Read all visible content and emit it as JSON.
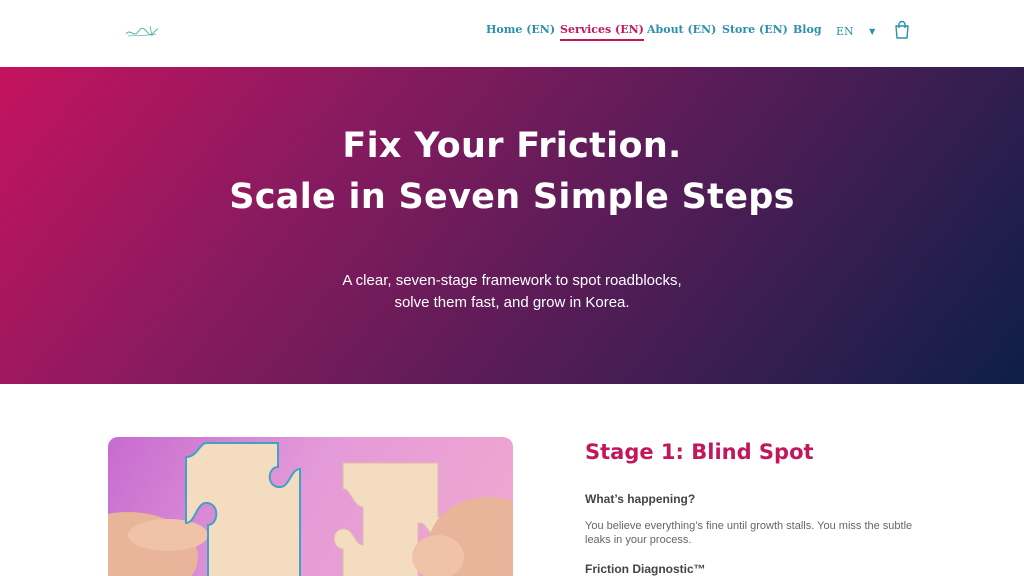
{
  "header": {
    "nav": [
      {
        "label": "Home (EN)"
      },
      {
        "label": "Services (EN)"
      },
      {
        "label": "About (EN)"
      },
      {
        "label": "Store (EN)"
      },
      {
        "label": "Blog"
      }
    ],
    "language": "EN"
  },
  "hero": {
    "title_line1": "Fix Your Friction.",
    "title_line2": "Scale in Seven Simple Steps",
    "subtitle_line1": "A clear, seven-stage framework to spot roadblocks,",
    "subtitle_line2": "solve them fast, and grow in Korea."
  },
  "stage": {
    "title": "Stage 1: Blind Spot",
    "question": "What’s happening?",
    "description": "You believe everything’s fine until growth stalls. You miss the subtle leaks in your process.",
    "next_label": "Friction Diagnostic™"
  },
  "colors": {
    "accent": "#c2185b",
    "nav": "#2a8fb0",
    "hero_start": "#c5135f",
    "hero_end": "#0d1f47"
  },
  "icons": {
    "cart": "shopping-bag-icon",
    "caret": "caret-down-icon",
    "logo": "signature-logo"
  }
}
